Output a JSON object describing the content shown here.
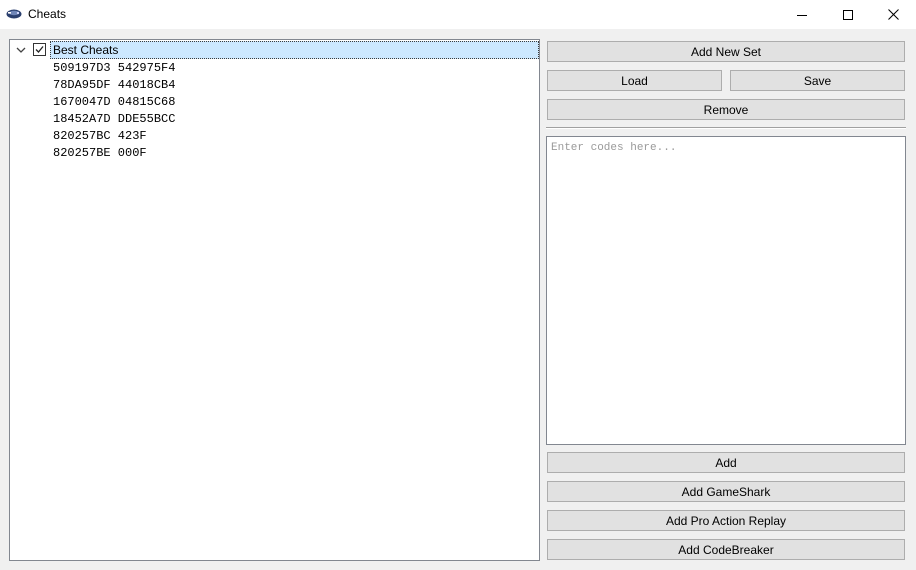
{
  "window": {
    "title": "Cheats",
    "icon": "gamecube-controller-icon",
    "controls": [
      "minimize-icon",
      "maximize-icon",
      "close-icon"
    ]
  },
  "tree": {
    "root": {
      "label": "Best Cheats",
      "checked": true,
      "expanded": true,
      "selected": true
    },
    "codes": [
      "509197D3 542975F4",
      "78DA95DF 44018CB4",
      "1670047D 04815C68",
      "18452A7D DDE55BCC",
      "820257BC 423F",
      "820257BE 000F"
    ]
  },
  "buttons": {
    "add_new_set": "Add New Set",
    "load": "Load",
    "save": "Save",
    "remove": "Remove",
    "add": "Add",
    "add_gameshark": "Add GameShark",
    "add_pro_action_replay": "Add Pro Action Replay",
    "add_codebreaker": "Add CodeBreaker"
  },
  "codes_input": {
    "value": "",
    "placeholder": "Enter codes here..."
  },
  "colors": {
    "selection": "#cce8ff",
    "button_face": "#e1e1e1",
    "button_border": "#adadad",
    "window_bg": "#f0f0f0"
  }
}
